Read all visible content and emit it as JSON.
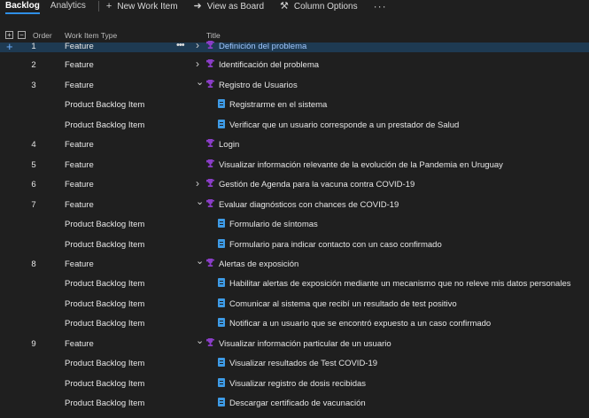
{
  "toolbar": {
    "tabs": [
      "Backlog",
      "Analytics"
    ],
    "new_work_item": "New Work Item",
    "view_as_board": "View as Board",
    "column_options": "Column Options",
    "more": "···"
  },
  "columns": {
    "order": "Order",
    "type": "Work Item Type",
    "title": "Title"
  },
  "rows": [
    {
      "order": "1",
      "type": "Feature",
      "title": "Definición del problema",
      "kind": "feature",
      "expander": "collapsed"
    },
    {
      "order": "2",
      "type": "Feature",
      "title": "Identificación del problema",
      "kind": "feature",
      "expander": "collapsed"
    },
    {
      "order": "3",
      "type": "Feature",
      "title": "Registro de Usuarios",
      "kind": "feature",
      "expander": "expanded"
    },
    {
      "order": "",
      "type": "Product Backlog Item",
      "title": "Registrarme en el sistema",
      "kind": "pbi"
    },
    {
      "order": "",
      "type": "Product Backlog Item",
      "title": "Verificar que un usuario corresponde a un prestador de Salud",
      "kind": "pbi"
    },
    {
      "order": "4",
      "type": "Feature",
      "title": "Login",
      "kind": "feature",
      "expander": ""
    },
    {
      "order": "5",
      "type": "Feature",
      "title": "Visualizar información relevante de la evolución de la Pandemia en Uruguay",
      "kind": "feature",
      "expander": ""
    },
    {
      "order": "6",
      "type": "Feature",
      "title": "Gestión de Agenda para la vacuna contra COVID-19",
      "kind": "feature",
      "expander": "collapsed"
    },
    {
      "order": "7",
      "type": "Feature",
      "title": "Evaluar diagnósticos con chances de COVID-19",
      "kind": "feature",
      "expander": "expanded"
    },
    {
      "order": "",
      "type": "Product Backlog Item",
      "title": "Formulario de síntomas",
      "kind": "pbi"
    },
    {
      "order": "",
      "type": "Product Backlog Item",
      "title": "Formulario para indicar contacto con un caso confirmado",
      "kind": "pbi"
    },
    {
      "order": "8",
      "type": "Feature",
      "title": "Alertas de exposición",
      "kind": "feature",
      "expander": "expanded"
    },
    {
      "order": "",
      "type": "Product Backlog Item",
      "title": "Habilitar alertas de exposición mediante un mecanismo que no releve mis datos personales",
      "kind": "pbi"
    },
    {
      "order": "",
      "type": "Product Backlog Item",
      "title": "Comunicar al sistema que recibí un resultado de test positivo",
      "kind": "pbi"
    },
    {
      "order": "",
      "type": "Product Backlog Item",
      "title": "Notificar a un usuario que se encontró expuesto a un caso confirmado",
      "kind": "pbi"
    },
    {
      "order": "9",
      "type": "Feature",
      "title": "Visualizar información particular de un usuario",
      "kind": "feature",
      "expander": "expanded"
    },
    {
      "order": "",
      "type": "Product Backlog Item",
      "title": "Visualizar resultados de Test COVID-19",
      "kind": "pbi"
    },
    {
      "order": "",
      "type": "Product Backlog Item",
      "title": "Visualizar registro de dosis recibidas",
      "kind": "pbi"
    },
    {
      "order": "",
      "type": "Product Backlog Item",
      "title": "Descargar certificado de vacunación",
      "kind": "pbi"
    }
  ],
  "colors": {
    "accent": "#2f8fe6",
    "feature_icon": "#8a3dc7",
    "pbi_icon": "#3e9be6",
    "selected_row": "#1e3a52"
  }
}
